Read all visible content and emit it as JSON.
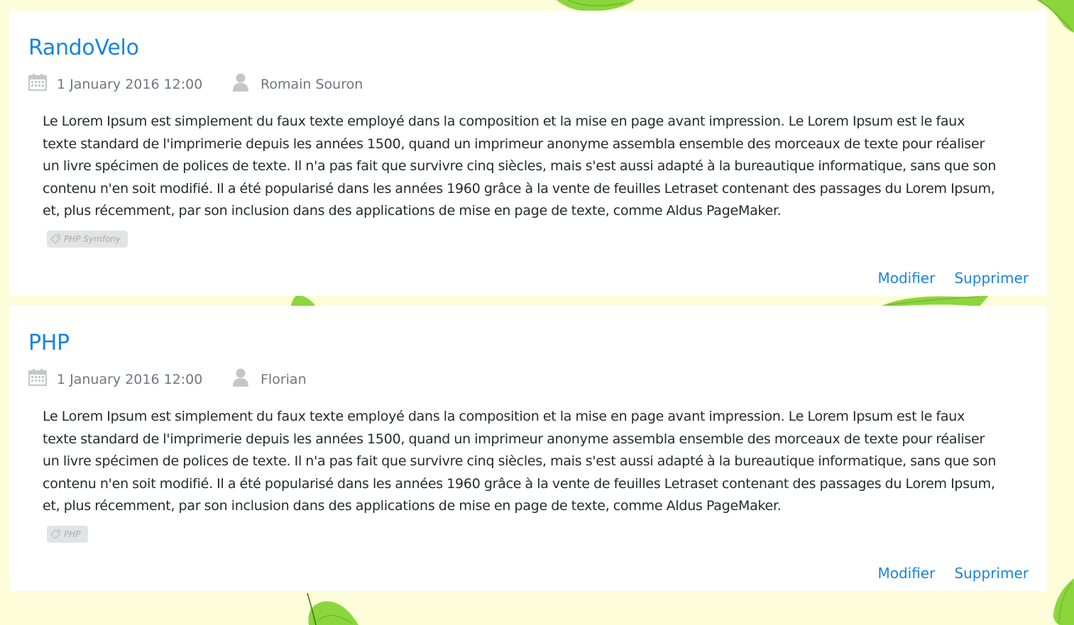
{
  "colors": {
    "page_background": "#fefdd9",
    "card_background": "#ffffff",
    "accent": "#1785e0",
    "meta_text": "#6f7780",
    "body_text": "#262a2e",
    "tag_background": "#e2e3e4",
    "leaf_green": "#8bd63c"
  },
  "posts": [
    {
      "title": "RandoVelo",
      "date": "1 January 2016 12:00",
      "author": "Romain Souron",
      "body": "Le Lorem Ipsum est simplement du faux texte employé dans la composition et la mise en page avant impression. Le Lorem Ipsum est le faux texte standard de l'imprimerie depuis les années 1500, quand un imprimeur anonyme assembla ensemble des morceaux de texte pour réaliser un livre spécimen de polices de texte. Il n'a pas fait que survivre cinq siècles, mais s'est aussi adapté à la bureautique informatique, sans que son contenu n'en soit modifié. Il a été popularisé dans les années 1960 grâce à la vente de feuilles Letraset contenant des passages du Lorem Ipsum, et, plus récemment, par son inclusion dans des applications de mise en page de texte, comme Aldus PageMaker.",
      "tag": "PHP Symfony",
      "edit_label": "Modifier",
      "delete_label": "Supprimer"
    },
    {
      "title": "PHP",
      "date": "1 January 2016 12:00",
      "author": "Florian",
      "body": "Le Lorem Ipsum est simplement du faux texte employé dans la composition et la mise en page avant impression. Le Lorem Ipsum est le faux texte standard de l'imprimerie depuis les années 1500, quand un imprimeur anonyme assembla ensemble des morceaux de texte pour réaliser un livre spécimen de polices de texte. Il n'a pas fait que survivre cinq siècles, mais s'est aussi adapté à la bureautique informatique, sans que son contenu n'en soit modifié. Il a été popularisé dans les années 1960 grâce à la vente de feuilles Letraset contenant des passages du Lorem Ipsum, et, plus récemment, par son inclusion dans des applications de mise en page de texte, comme Aldus PageMaker.",
      "tag": "PHP",
      "edit_label": "Modifier",
      "delete_label": "Supprimer"
    }
  ]
}
